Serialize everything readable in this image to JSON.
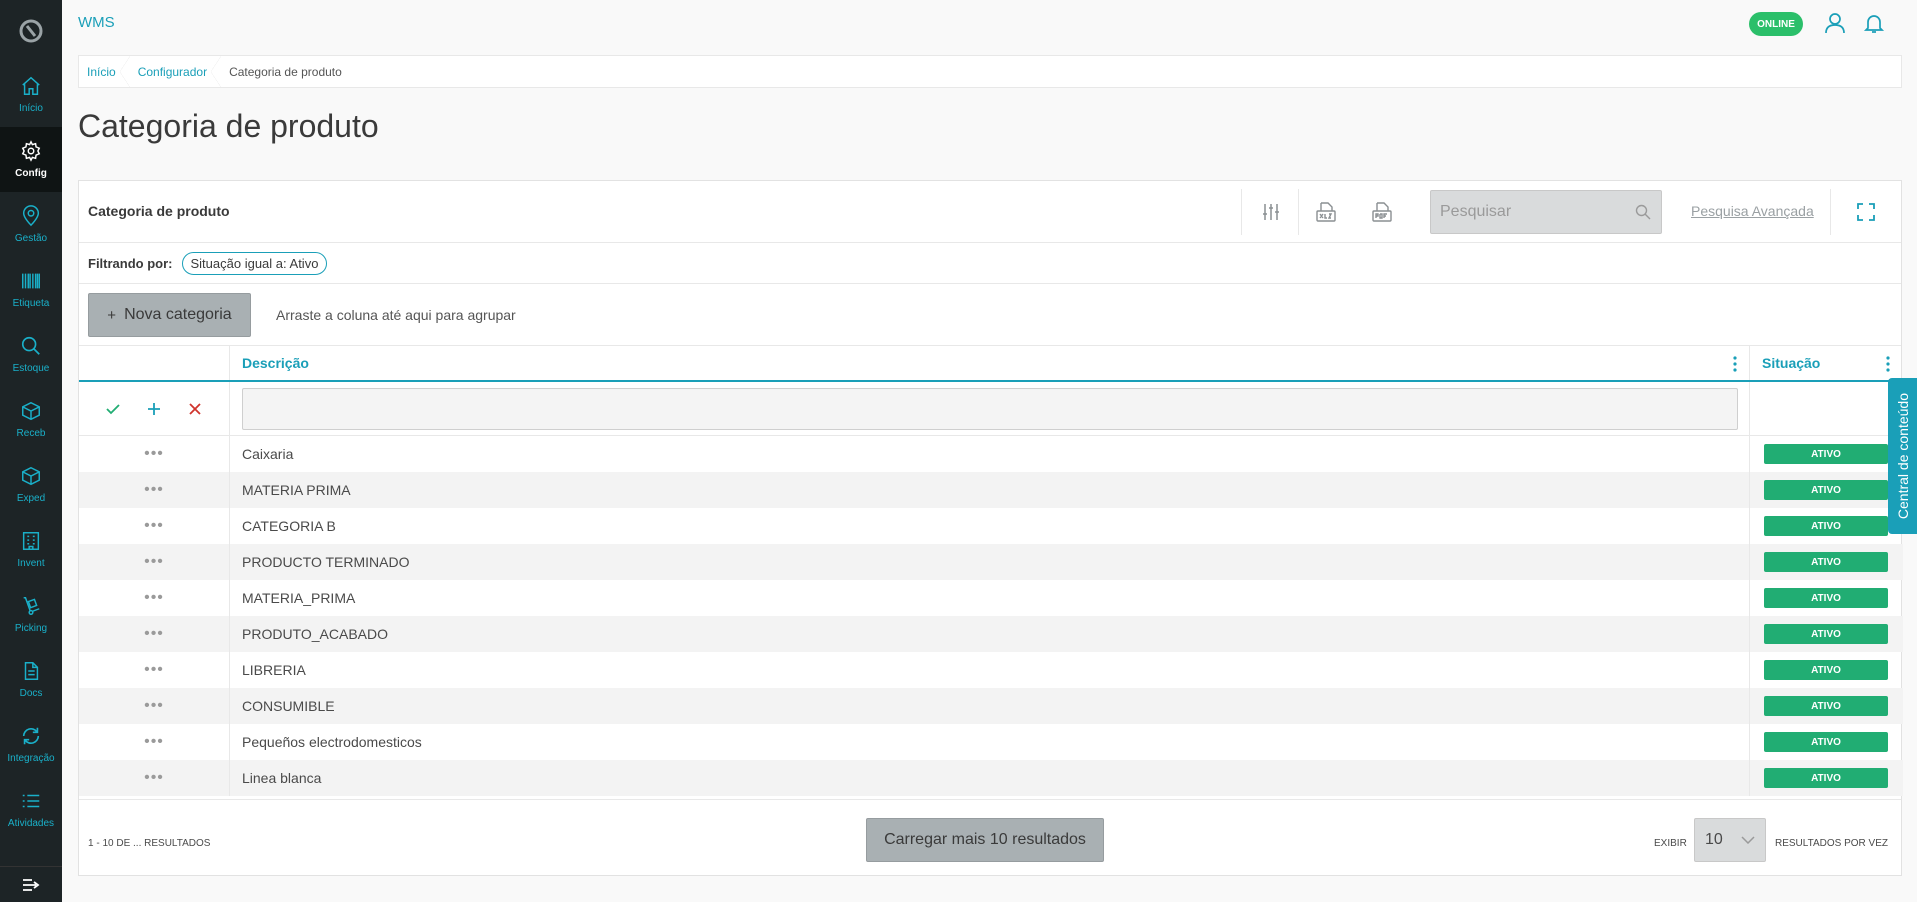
{
  "app": {
    "title": "WMS",
    "status": "ONLINE"
  },
  "sidebar": {
    "items": [
      {
        "label": "Início",
        "icon": "home-icon"
      },
      {
        "label": "Config",
        "icon": "gear-icon",
        "active": true
      },
      {
        "label": "Gestão",
        "icon": "map-pin-icon"
      },
      {
        "label": "Etiqueta",
        "icon": "barcode-icon"
      },
      {
        "label": "Estoque",
        "icon": "search-icon"
      },
      {
        "label": "Receb",
        "icon": "box-icon"
      },
      {
        "label": "Exped",
        "icon": "box-icon"
      },
      {
        "label": "Invent",
        "icon": "building-icon"
      },
      {
        "label": "Picking",
        "icon": "hand-truck-icon"
      },
      {
        "label": "Docs",
        "icon": "document-icon"
      },
      {
        "label": "Integração",
        "icon": "sync-icon"
      },
      {
        "label": "Atividades",
        "icon": "list-icon"
      }
    ]
  },
  "breadcrumb": {
    "items": [
      "Início",
      "Configurador"
    ],
    "current": "Categoria de produto"
  },
  "page": {
    "title": "Categoria de produto"
  },
  "panel": {
    "title": "Categoria de produto",
    "search_placeholder": "Pesquisar",
    "advanced_search": "Pesquisa Avançada",
    "filter_label": "Filtrando por:",
    "filter_chip": "Situação igual a: Ativo",
    "new_button": "Nova categoria",
    "group_hint": "Arraste a coluna até aqui para agrupar"
  },
  "table": {
    "columns": {
      "description": "Descrição",
      "status": "Situação"
    },
    "rows": [
      {
        "description": "Caixaria",
        "status": "ATIVO"
      },
      {
        "description": "MATERIA PRIMA",
        "status": "ATIVO"
      },
      {
        "description": "CATEGORIA B",
        "status": "ATIVO"
      },
      {
        "description": "PRODUCTO TERMINADO",
        "status": "ATIVO"
      },
      {
        "description": "MATERIA_PRIMA",
        "status": "ATIVO"
      },
      {
        "description": "PRODUTO_ACABADO",
        "status": "ATIVO"
      },
      {
        "description": "LIBRERIA",
        "status": "ATIVO"
      },
      {
        "description": "CONSUMIBLE",
        "status": "ATIVO"
      },
      {
        "description": "Pequeños electrodomesticos",
        "status": "ATIVO"
      },
      {
        "description": "Linea blanca",
        "status": "ATIVO"
      }
    ]
  },
  "footer": {
    "results": "1 - 10 DE ... RESULTADOS",
    "load_more": "Carregar mais 10 resultados",
    "show_label": "EXIBIR",
    "page_size": "10",
    "per_page_label": "RESULTADOS POR VEZ"
  },
  "side_tab": "Central de conteúdo",
  "colors": {
    "accent": "#1a9fb8",
    "sidebar": "#1d2426",
    "status_active": "#21ad73",
    "online": "#2bbf6a"
  }
}
